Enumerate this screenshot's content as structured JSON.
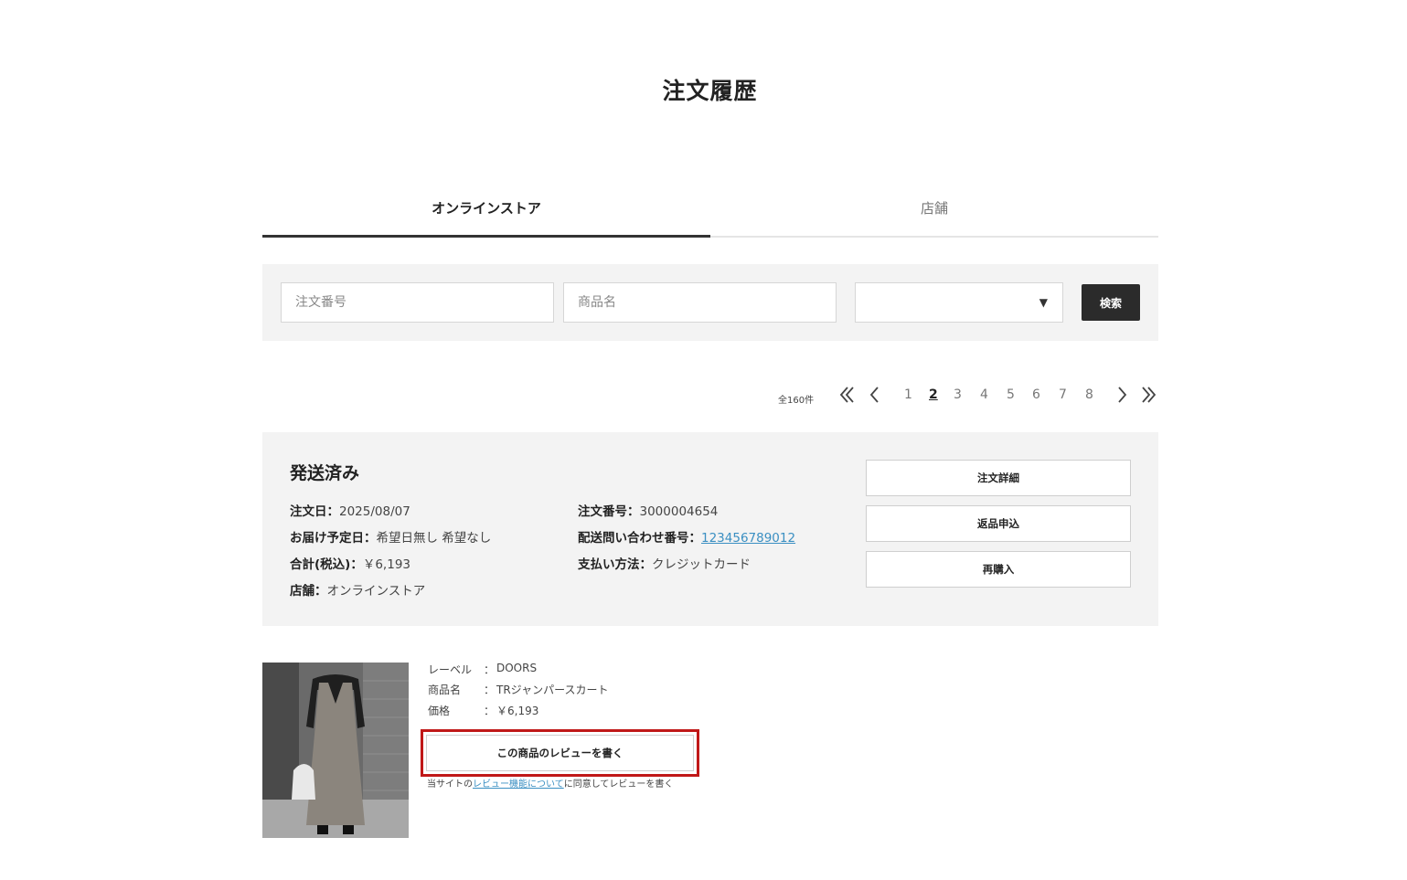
{
  "page": {
    "title": "注文履歴"
  },
  "tabs": [
    {
      "label": "オンラインストア",
      "active": true
    },
    {
      "label": "店舗",
      "active": false
    }
  ],
  "search": {
    "order_number_placeholder": "注文番号",
    "product_name_placeholder": "商品名",
    "select_value": "",
    "select_icon": "triangle-down-icon",
    "button_label": "検索"
  },
  "pagination": {
    "total": "全160件",
    "first_icon": "double-chevron-left-icon",
    "prev_icon": "chevron-left-icon",
    "pages": [
      "1",
      "2",
      "3",
      "4",
      "5",
      "6",
      "7",
      "8"
    ],
    "current_page": "2",
    "next_icon": "chevron-right-icon",
    "last_icon": "double-chevron-right-icon"
  },
  "order": {
    "status": "発送済み",
    "order_date_label": "注文日：",
    "order_date": "2025/08/07",
    "delivery_label": "お届け予定日：",
    "delivery_value": "希望日無し 希望なし",
    "total_label": "合計(税込)：",
    "total_value": "￥6,193",
    "store_label": "店舗：",
    "store_value": "オンラインストア",
    "order_number_label": "注文番号：",
    "order_number": "3000004654",
    "tracking_label": "配送問い合わせ番号：",
    "tracking_number": "123456789012",
    "payment_label": "支払い方法：",
    "payment_value": "クレジットカード",
    "buttons": {
      "detail": "注文詳細",
      "return": "返品申込",
      "repurchase": "再購入"
    }
  },
  "product": {
    "label_key": "レーベル",
    "label_value": "DOORS",
    "name_key": "商品名",
    "name_value": "TRジャンパースカート",
    "price_key": "価格",
    "price_value": "￥6,193",
    "colon": "：",
    "review_button": "この商品のレビューを書く",
    "review_note_prefix": "当サイトの",
    "review_note_link": "レビュー機能について",
    "review_note_suffix": "に同意してレビューを書く"
  },
  "colors": {
    "accent_dark": "#2b2b2b",
    "link": "#3a8fc2",
    "highlight": "#c01818",
    "panel_bg": "#f3f3f3"
  }
}
